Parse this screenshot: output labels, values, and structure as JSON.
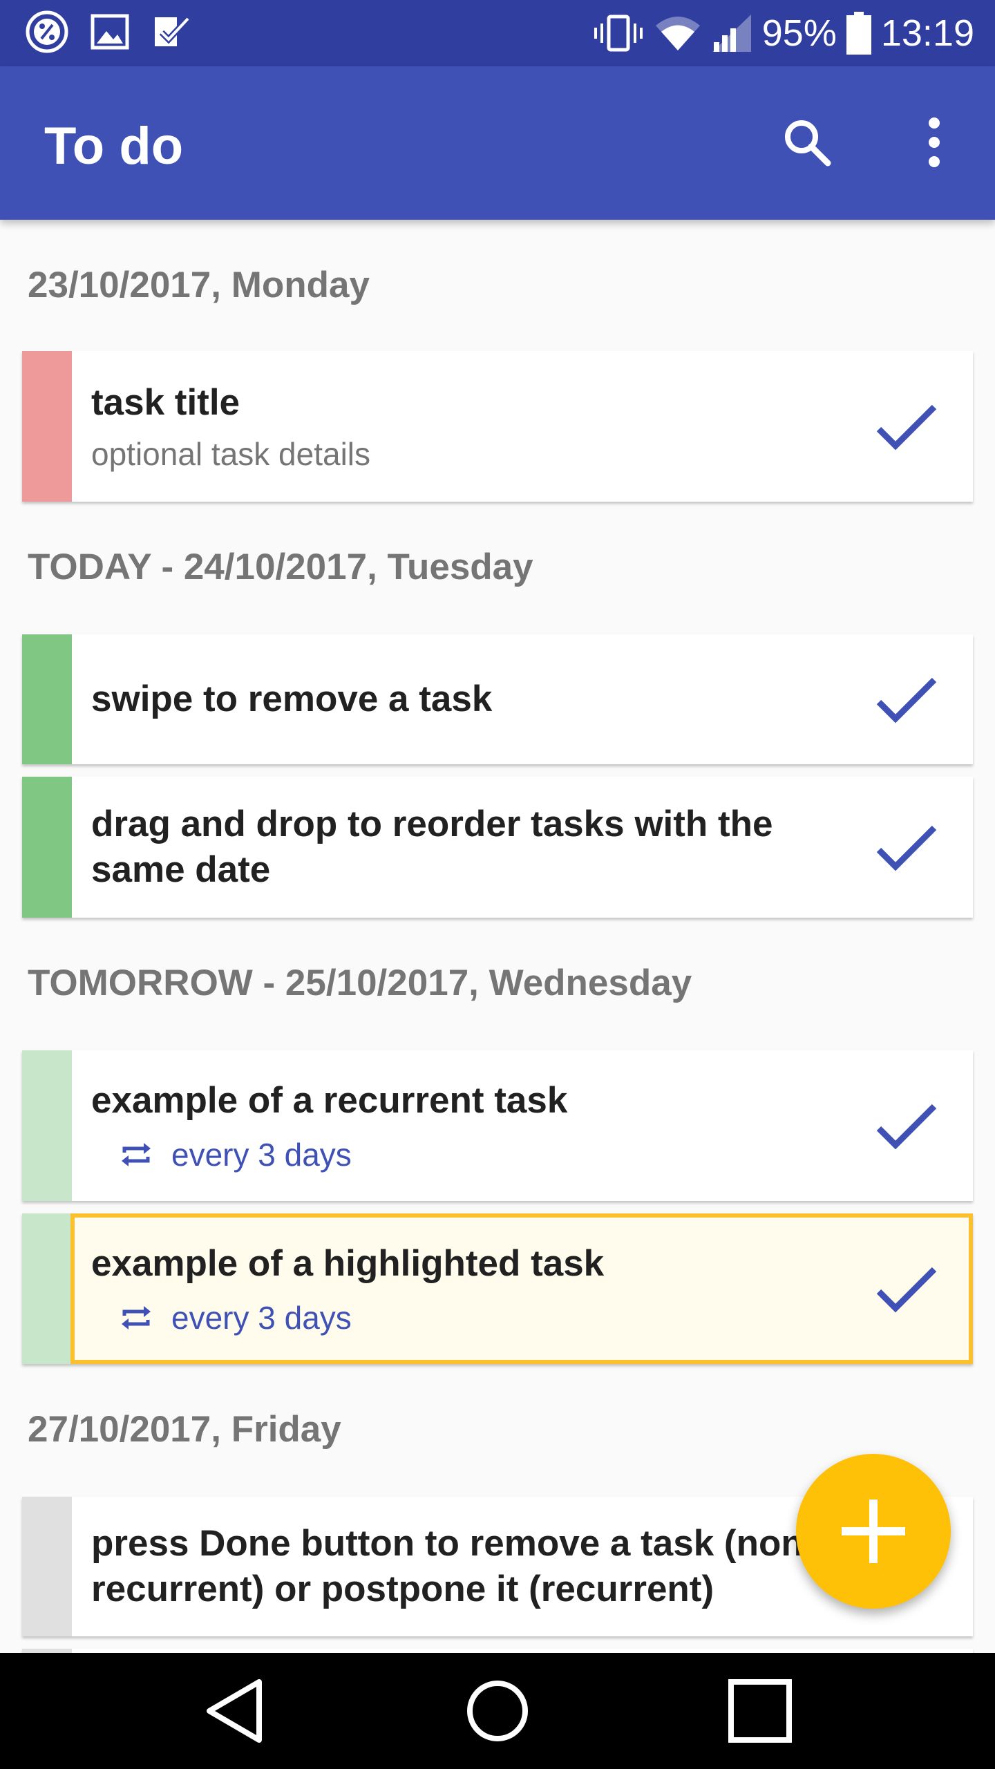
{
  "status_bar": {
    "battery": "95%",
    "time": "13:19"
  },
  "app_bar": {
    "title": "To do"
  },
  "sections": [
    {
      "header": "23/10/2017, Monday"
    },
    {
      "header": "TODAY - 24/10/2017, Tuesday"
    },
    {
      "header": "TOMORROW - 25/10/2017, Wednesday"
    },
    {
      "header": "27/10/2017, Friday"
    }
  ],
  "tasks": [
    {
      "title": "task title",
      "details": "optional task details",
      "color": "#ef9a9a"
    },
    {
      "title": "swipe to remove a task",
      "color": "#81c784"
    },
    {
      "title": "drag and drop to reorder tasks with the same date",
      "color": "#81c784"
    },
    {
      "title": "example of a recurrent task",
      "recurrence": "every 3 days",
      "color": "#c8e6c9"
    },
    {
      "title": "example of a highlighted task",
      "recurrence": "every 3 days",
      "color": "#c8e6c9",
      "highlight": "#fbc02d"
    },
    {
      "title": "press Done button to remove a task (non-recurrent) or postpone it (recurrent)",
      "color": "#e0e0e0"
    }
  ],
  "colors": {
    "primary": "#3f51b5",
    "primary_dark": "#303f9f",
    "accent": "#ffc107"
  },
  "icons": {
    "status_left": [
      "percent-icon",
      "image-icon",
      "checklist-icon"
    ],
    "status_right": [
      "vibrate-icon",
      "wifi-icon",
      "signal-icon",
      "battery-icon"
    ],
    "app_bar": [
      "search-icon",
      "more-vert-icon"
    ],
    "task_action": "check-icon",
    "recurrence": "repeat-icon",
    "fab": "add-icon",
    "nav": [
      "back-icon",
      "home-icon",
      "recents-icon"
    ]
  }
}
